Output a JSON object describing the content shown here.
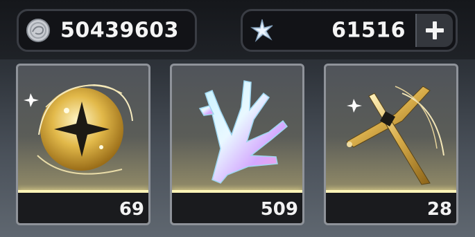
{
  "currencies": {
    "coin": {
      "icon": "silver-coin-icon",
      "value": "50439603"
    },
    "star": {
      "icon": "star-crystal-icon",
      "value": "61516",
      "add_button": "plus-icon"
    }
  },
  "items": [
    {
      "name": "golden-swirl-orb",
      "icon": "golden-orb-icon",
      "count": "69"
    },
    {
      "name": "iridescent-crystal-coral",
      "icon": "crystal-coral-icon",
      "count": "509"
    },
    {
      "name": "golden-blade-shard",
      "icon": "golden-blade-icon",
      "count": "28"
    }
  ],
  "colors": {
    "card_glow": "#e8dc9c",
    "accent_line": "#fff4b8",
    "count_strip": "#1a1b1e",
    "frame": "#8f939a"
  }
}
